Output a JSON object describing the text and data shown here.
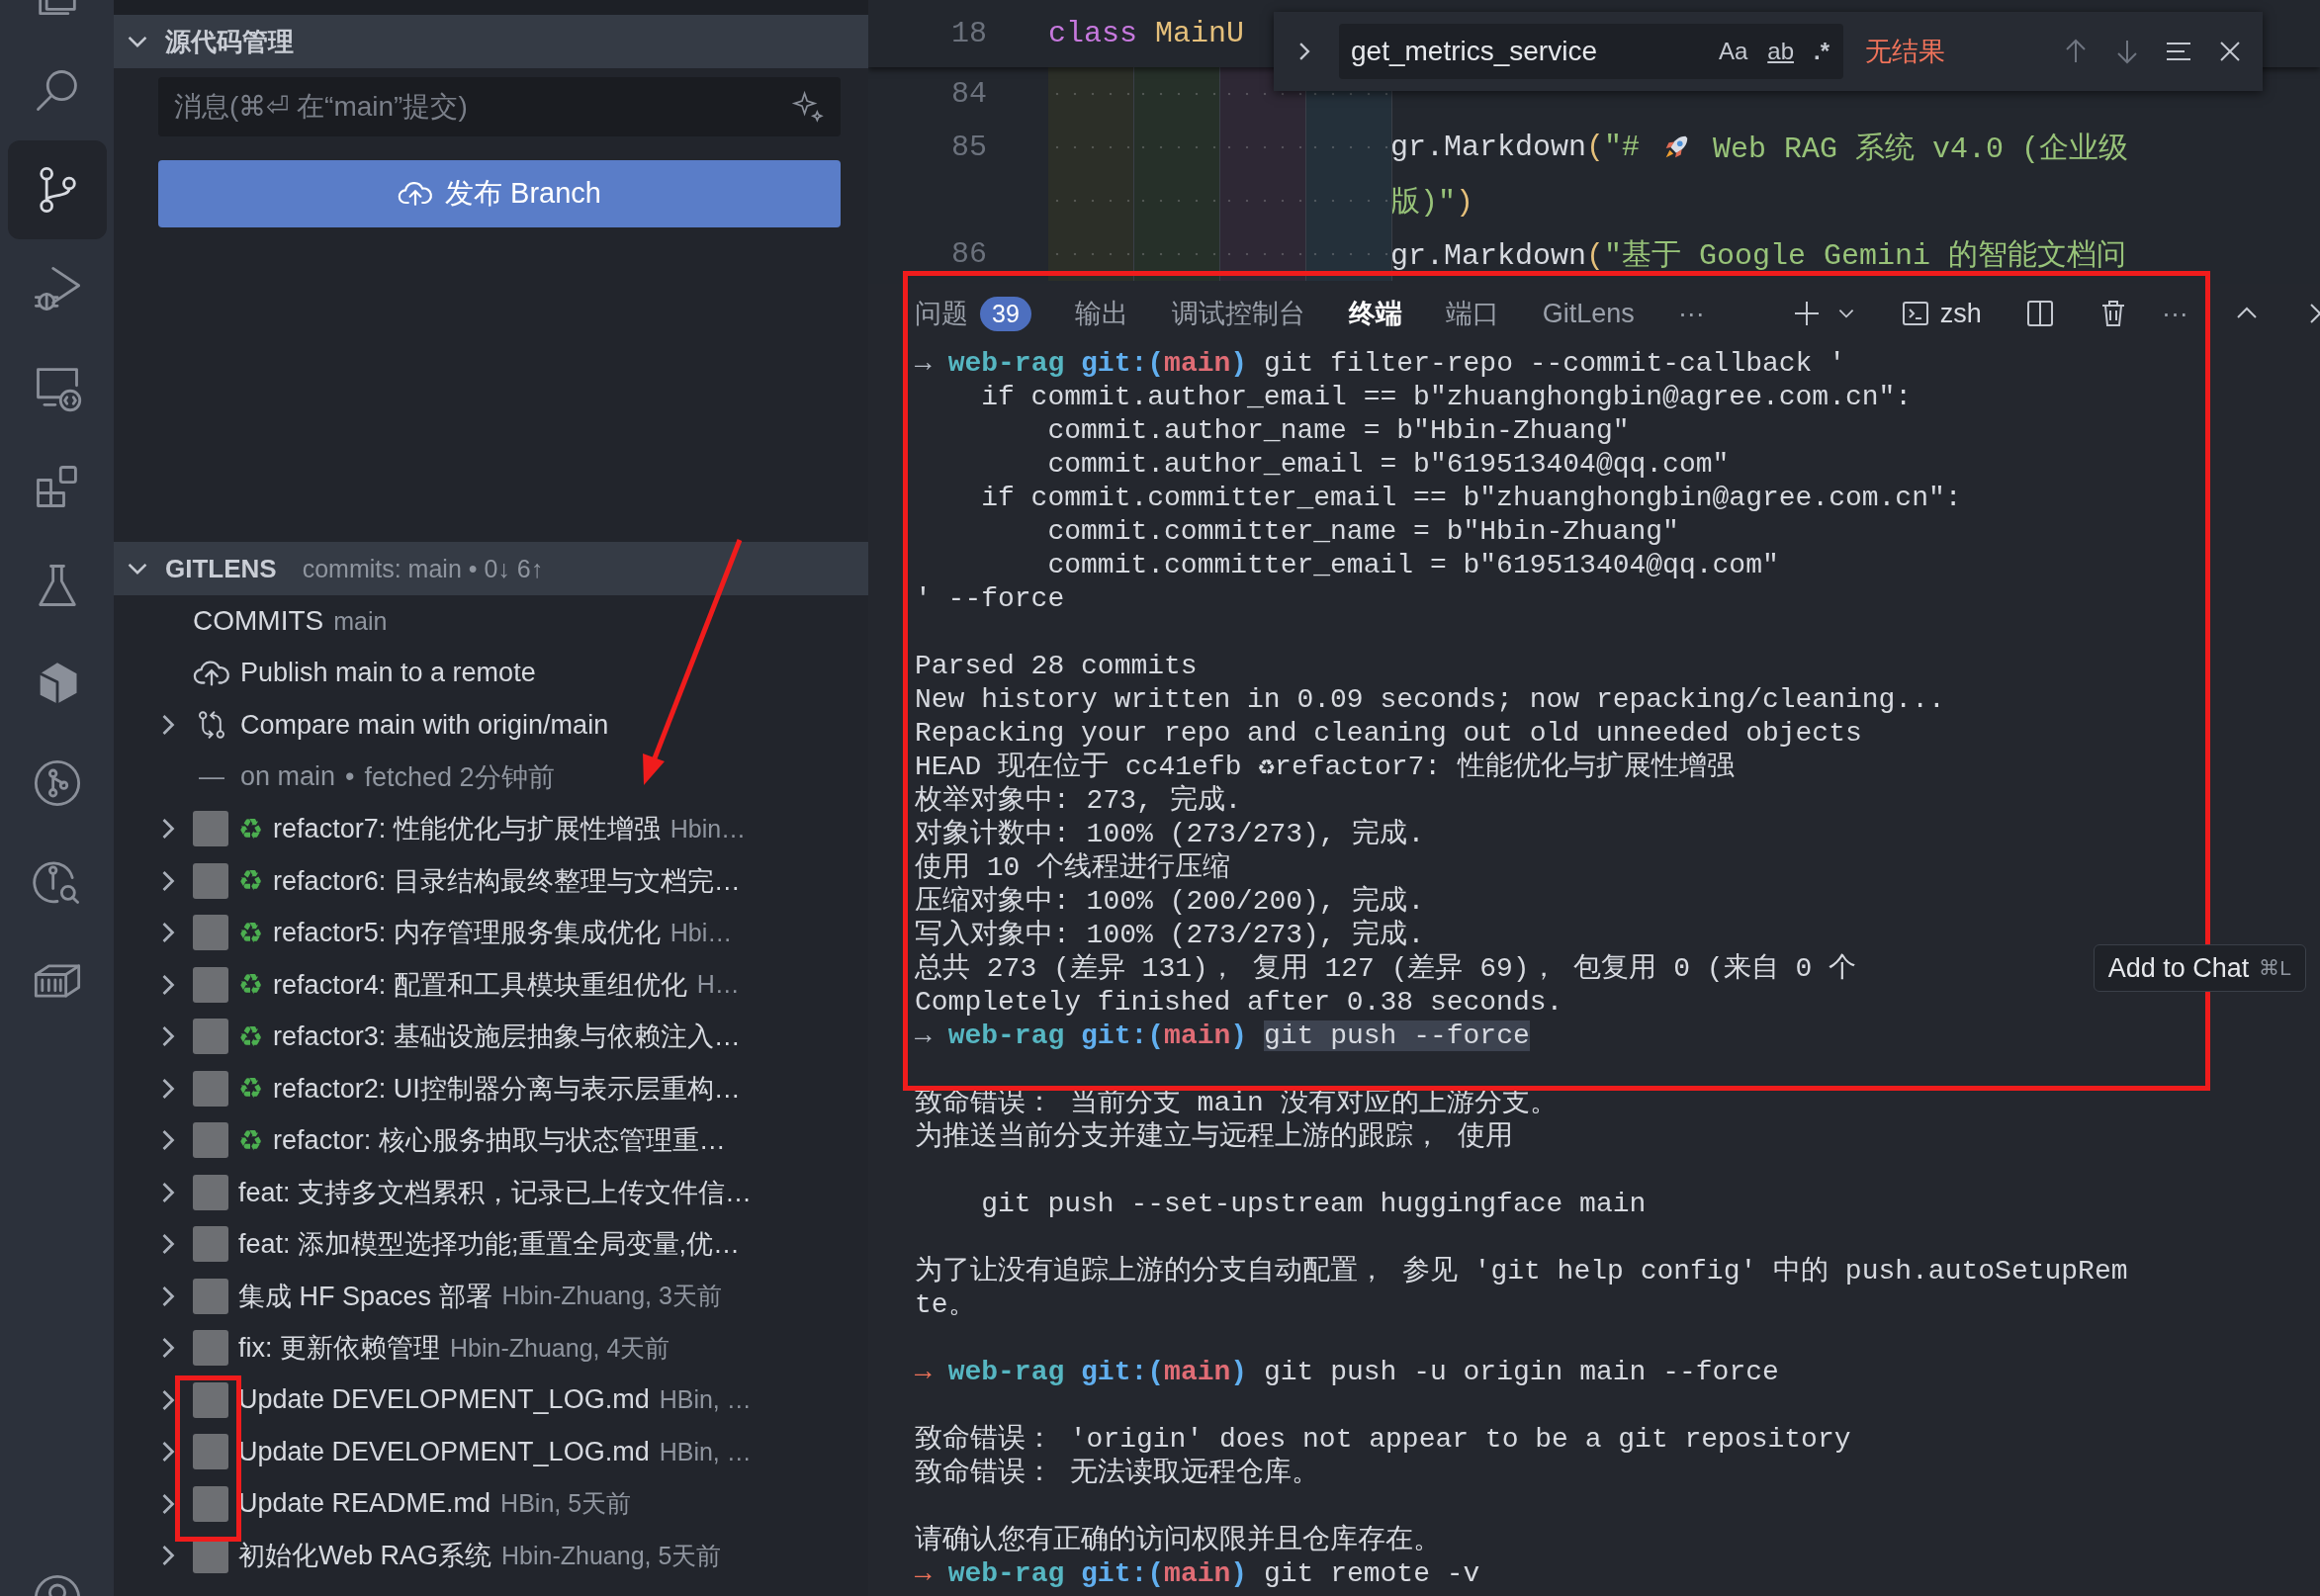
{
  "activity_bar": {
    "items": [
      {
        "kind": "explorer",
        "selected": false
      },
      {
        "kind": "search",
        "selected": false
      },
      {
        "kind": "scm",
        "selected": true
      },
      {
        "kind": "debug",
        "selected": false
      },
      {
        "kind": "remote",
        "selected": false
      },
      {
        "kind": "extensions",
        "selected": false
      },
      {
        "kind": "testing",
        "selected": false
      },
      {
        "kind": "cube",
        "selected": false
      },
      {
        "kind": "graph",
        "selected": false
      },
      {
        "kind": "commit_search",
        "selected": false
      },
      {
        "kind": "container",
        "selected": false
      },
      {
        "kind": "account",
        "selected": false
      }
    ]
  },
  "scm": {
    "title": "源代码管理",
    "expanded": true,
    "message_placeholder": "消息(⌘⏎ 在“main”提交)",
    "publish_button": "发布 Branch"
  },
  "gitlens": {
    "title": "GITLENS",
    "description": "commits: main • 0↓ 6↑",
    "expanded": true,
    "commits_label": "COMMITS",
    "commits_branch": "main",
    "publish": "Publish main to a remote",
    "compare": {
      "label": "Compare main with origin/main",
      "expanded": false
    },
    "status": {
      "dash": "—",
      "branch": "on main",
      "separator": "•",
      "fetched": "fetched 2分钟前"
    },
    "commits": [
      {
        "icon": "♻",
        "message": "refactor7: 性能优化与扩展性增强",
        "meta": "Hbin…",
        "expanded": false
      },
      {
        "icon": "♻",
        "message": "refactor6: 目录结构最终整理与文档完…",
        "expanded": false
      },
      {
        "icon": "♻",
        "message": "refactor5: 内存管理服务集成优化",
        "meta": "Hbi…",
        "expanded": false
      },
      {
        "icon": "♻",
        "message": "refactor4: 配置和工具模块重组优化",
        "meta": "H…",
        "expanded": false
      },
      {
        "icon": "♻",
        "message": "refactor3: 基础设施层抽象与依赖注入…",
        "expanded": false
      },
      {
        "icon": "♻",
        "message": "refactor2: UI控制器分离与表示层重构…",
        "expanded": false
      },
      {
        "icon": "♻",
        "message": "refactor: 核心服务抽取与状态管理重…",
        "expanded": false
      },
      {
        "message": "feat: 支持多文档累积，记录已上传文件信…",
        "expanded": false
      },
      {
        "message": "feat: 添加模型选择功能;重置全局变量,优…",
        "expanded": false
      },
      {
        "message": "集成 HF Spaces 部署",
        "meta": "Hbin-Zhuang, 3天前",
        "expanded": false
      },
      {
        "message": "fix: 更新依赖管理",
        "meta": "Hbin-Zhuang, 4天前",
        "expanded": false
      },
      {
        "message": "Update DEVELOPMENT_LOG.md",
        "meta": "HBin, …",
        "expanded": false
      },
      {
        "message": "Update DEVELOPMENT_LOG.md",
        "meta": "HBin, …",
        "expanded": false
      },
      {
        "message": "Update README.md",
        "meta": "HBin, 5天前",
        "expanded": false
      },
      {
        "message": "初始化Web RAG系统",
        "meta": "Hbin-Zhuang, 5天前",
        "expanded": false
      }
    ]
  },
  "editor": {
    "sticky": {
      "number": "18",
      "tokens": [
        {
          "kind": "kw",
          "text": "class "
        },
        {
          "kind": "cls",
          "text": "MainU"
        }
      ]
    },
    "rows": [
      {
        "number": "84",
        "parts": []
      },
      {
        "number": "85",
        "parts": [
          {
            "kind": "text",
            "tokens": [
              {
                "kind": "fn",
                "text": "gr.Markdown"
              },
              {
                "kind": "paren",
                "text": "("
              },
              {
                "kind": "str",
                "text": "\"# "
              }
            ]
          },
          {
            "kind": "rocket"
          },
          {
            "kind": "text",
            "tokens": [
              {
                "kind": "str",
                "text": " Web RAG 系统 v4.0 (企业级"
              }
            ]
          }
        ]
      },
      {
        "parts": [
          {
            "kind": "text",
            "tokens": [
              {
                "kind": "str",
                "text": "版)\""
              },
              {
                "kind": "paren",
                "text": ")"
              }
            ]
          }
        ]
      },
      {
        "number": "86",
        "parts": [
          {
            "kind": "text",
            "tokens": [
              {
                "kind": "fn",
                "text": "gr.Markdown"
              },
              {
                "kind": "paren",
                "text": "("
              },
              {
                "kind": "str",
                "text": "\"基于 Google Gemini 的智能文档问"
              }
            ]
          }
        ]
      }
    ]
  },
  "find_widget": {
    "expanded": false,
    "value": "get_metrics_service",
    "toggles": [
      {
        "kind": "case",
        "label": "Aa",
        "on": false
      },
      {
        "kind": "word",
        "label": "ab",
        "on": false
      },
      {
        "kind": "regex",
        "label": ".*",
        "on": false
      }
    ],
    "result": "无结果"
  },
  "panel": {
    "tabs": [
      {
        "label": "问题",
        "badge": "39",
        "selected": false
      },
      {
        "label": "输出",
        "selected": false
      },
      {
        "label": "调试控制台",
        "selected": false
      },
      {
        "label": "终端",
        "selected": true
      },
      {
        "label": "端口",
        "selected": false
      },
      {
        "label": "GitLens",
        "selected": false
      }
    ],
    "overflow": "···",
    "shell": "zsh",
    "more": "···"
  },
  "terminal": {
    "tooltip": {
      "label": "Add to Chat",
      "shortcut": "⌘L"
    },
    "lines": [
      {
        "kind": "prompt",
        "failed": false,
        "arrow": "→",
        "dir": "web-rag",
        "vcs": "git:(",
        "branch": "main",
        "vcs_end": ")",
        "command": "git filter-repo --commit-callback '",
        "highlighted": false
      },
      {
        "kind": "text",
        "text": "    if commit.author_email == b\"zhuanghongbin@agree.com.cn\":"
      },
      {
        "kind": "text",
        "text": "        commit.author_name = b\"Hbin-Zhuang\""
      },
      {
        "kind": "text",
        "text": "        commit.author_email = b\"619513404@qq.com\""
      },
      {
        "kind": "text",
        "text": "    if commit.committer_email == b\"zhuanghongbin@agree.com.cn\":"
      },
      {
        "kind": "text",
        "text": "        commit.committer_name = b\"Hbin-Zhuang\""
      },
      {
        "kind": "text",
        "text": "        commit.committer_email = b\"619513404@qq.com\""
      },
      {
        "kind": "text",
        "text": "' --force"
      },
      {
        "kind": "blank"
      },
      {
        "kind": "text",
        "text": "Parsed 28 commits"
      },
      {
        "kind": "text",
        "text": "New history written in 0.09 seconds; now repacking/cleaning..."
      },
      {
        "kind": "text",
        "text": "Repacking your repo and cleaning out old unneeded objects"
      },
      {
        "kind": "text",
        "text": "HEAD 现在位于 cc41efb ♻refactor7: 性能优化与扩展性增强"
      },
      {
        "kind": "text",
        "text": "枚举对象中: 273, 完成."
      },
      {
        "kind": "text",
        "text": "对象计数中: 100% (273/273), 完成."
      },
      {
        "kind": "text",
        "text": "使用 10 个线程进行压缩"
      },
      {
        "kind": "text",
        "text": "压缩对象中: 100% (200/200), 完成."
      },
      {
        "kind": "text",
        "text": "写入对象中: 100% (273/273), 完成."
      },
      {
        "kind": "text",
        "text": "总共 273 (差异 131)， 复用 127 (差异 69)， 包复用 0 (来自 0 个"
      },
      {
        "kind": "text",
        "text": "Completely finished after 0.38 seconds."
      },
      {
        "kind": "prompt",
        "failed": false,
        "arrow": "→",
        "dir": "web-rag",
        "vcs": "git:(",
        "branch": "main",
        "vcs_end": ")",
        "command": "git push --force",
        "highlighted": true
      },
      {
        "kind": "blank"
      },
      {
        "kind": "text",
        "text": "致命错误： 当前分支 main 没有对应的上游分支。"
      },
      {
        "kind": "text",
        "text": "为推送当前分支并建立与远程上游的跟踪， 使用"
      },
      {
        "kind": "blank"
      },
      {
        "kind": "text",
        "text": "    git push --set-upstream huggingface main"
      },
      {
        "kind": "blank"
      },
      {
        "kind": "text",
        "text": "为了让没有追踪上游的分支自动配置， 参见 'git help config' 中的 push.autoSetupRem"
      },
      {
        "kind": "text",
        "text": "te。"
      },
      {
        "kind": "blank"
      },
      {
        "kind": "prompt",
        "failed": true,
        "arrow": "→",
        "dir": "web-rag",
        "vcs": "git:(",
        "branch": "main",
        "vcs_end": ")",
        "command": "git push -u origin main --force",
        "highlighted": false
      },
      {
        "kind": "blank"
      },
      {
        "kind": "text",
        "text": "致命错误： 'origin' does not appear to be a git repository"
      },
      {
        "kind": "text",
        "text": "致命错误： 无法读取远程仓库。"
      },
      {
        "kind": "blank"
      },
      {
        "kind": "text",
        "text": "请确认您有正确的访问权限并且仓库存在。"
      },
      {
        "kind": "prompt",
        "failed": true,
        "arrow": "→",
        "dir": "web-rag",
        "vcs": "git:(",
        "branch": "main",
        "vcs_end": ")",
        "command": "git remote -v",
        "highlighted": false
      }
    ]
  }
}
